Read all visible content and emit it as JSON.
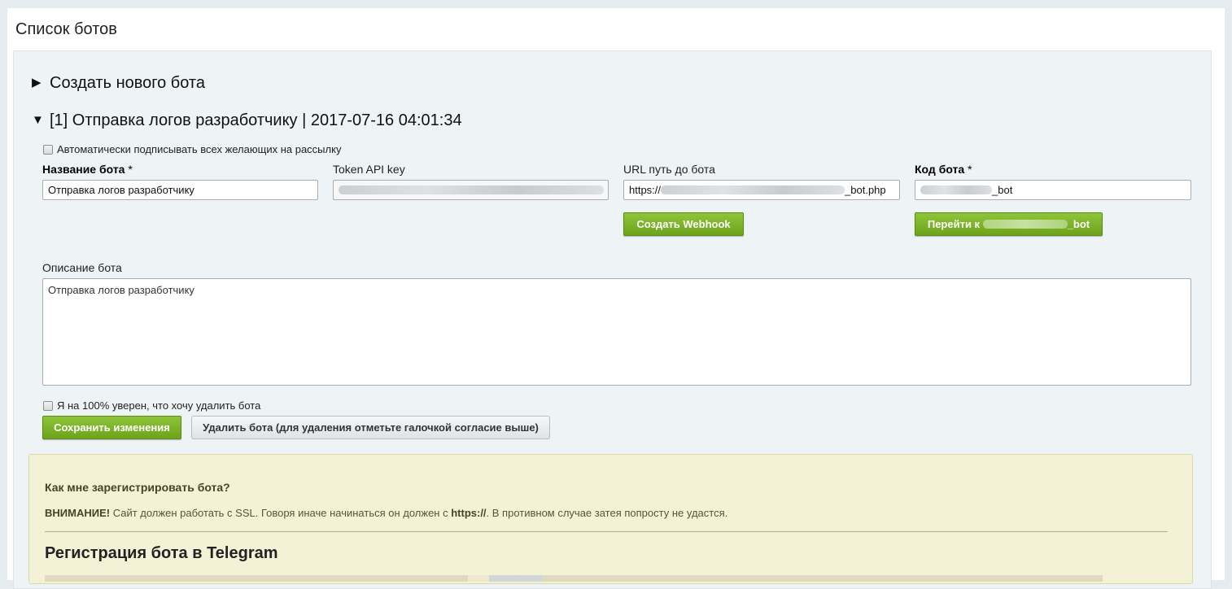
{
  "page": {
    "title": "Список ботов"
  },
  "sections": {
    "create_toggle": "Создать нового бота",
    "bot_header": "[1] Отправка логов разработчику | 2017-07-16 04:01:34"
  },
  "bot_form": {
    "auto_subscribe_label": "Автоматически подписывать всех желающих на рассылку",
    "name_label": "Название бота",
    "name_value": "Отправка логов разработчику",
    "token_label": "Token API key",
    "url_label": "URL путь до бота",
    "url_prefix": "https://",
    "url_suffix": "_bot.php",
    "code_label": "Код бота",
    "code_suffix": "_bot",
    "required_mark": "*",
    "create_webhook_button": "Создать Webhook",
    "goto_button_prefix": "Перейти к",
    "goto_button_suffix": "_bot",
    "description_label": "Описание бота",
    "description_value": "Отправка логов разработчику",
    "confirm_delete_label": "Я на 100% уверен, что хочу удалить бота",
    "save_button": "Сохранить изменения",
    "delete_button": "Удалить бота (для удаления отметьте галочкой согласие выше)"
  },
  "info_box": {
    "question": "Как мне зарегистрировать бота?",
    "warning_strong": "ВНИМАНИЕ!",
    "warning_text": " Сайт должен работать с SSL. Говоря иначе начинаться он должен с ",
    "warning_https": "https://",
    "warning_tail": ". В противном случае затея попросту не удастся.",
    "heading": "Регистрация бота в Telegram"
  },
  "colors": {
    "primary_button": "#7ab025",
    "panel_background": "#eef3f5",
    "info_background": "#f4f2d6"
  }
}
